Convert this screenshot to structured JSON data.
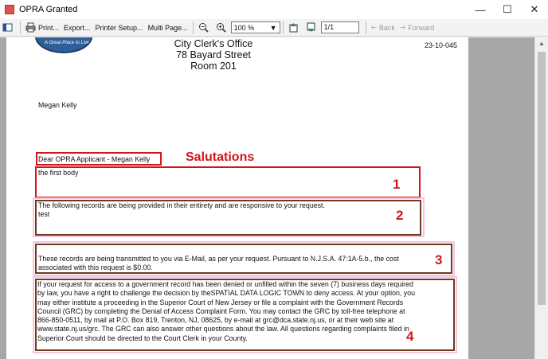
{
  "window": {
    "title": "OPRA Granted"
  },
  "toolbar": {
    "print_label": "Print...",
    "export_label": "Export...",
    "printer_setup_label": "Printer Setup...",
    "multi_page_label": "Multi Page...",
    "zoom_value": "100 %",
    "page_value": "1/1",
    "back_label": "Back",
    "forward_label": "Forward"
  },
  "document": {
    "logo_text": "A Great Place to Live",
    "header_lines": [
      "City Clerk's Office",
      "78 Bayard Street",
      "Room 201"
    ],
    "doc_number": "23-10-045",
    "recipient": "Megan Kelly",
    "salutation": "Dear OPRA Applicant - Megan Kelly",
    "first_body": "the first body",
    "records_line": "The following records are being provided in their entirety and are responsive to your request.",
    "records_extra": "test",
    "transmit_line1": "These records are being transmitted to you via E-Mail, as per your request.  Pursuant to N.J.S.A. 47:1A-5.b., the cost",
    "transmit_line2": "associated with this request is $0.00.",
    "denial_lines": [
      "If your request for access to a  government record has been denied or unfilled within the seven (7) business days required",
      "by law, you have  a right to challenge the  decision by theSPATIAL DATA LOGIC TOWN to deny access.  At your option, you",
      "may  either institute a proceeding in the Superior Court of New Jersey or file  a complaint with the Government Records",
      "Council (GRC) by completing the Denial of Access Complaint Form.  You may contact the GRC by toll-free telephone at",
      "866-850-0511, by mail at P.O. Box 819, Trenton, NJ, 08625,  by e-mail at grc@dca.state.nj.us, or at their web site at",
      "www.state.nj.us/grc. The GRC can also answer other questions about the law.   All questions regarding complaints filed in",
      "Superior Court should be directed to the  Court Clerk in your County."
    ]
  },
  "annotations": {
    "salutations_label": "Salutations",
    "num1": "1",
    "num2": "2",
    "num3": "3",
    "num4": "4",
    "colors": {
      "red": "#d4141c",
      "brown": "#6e3a1e",
      "pink": "#f2c6df"
    }
  }
}
